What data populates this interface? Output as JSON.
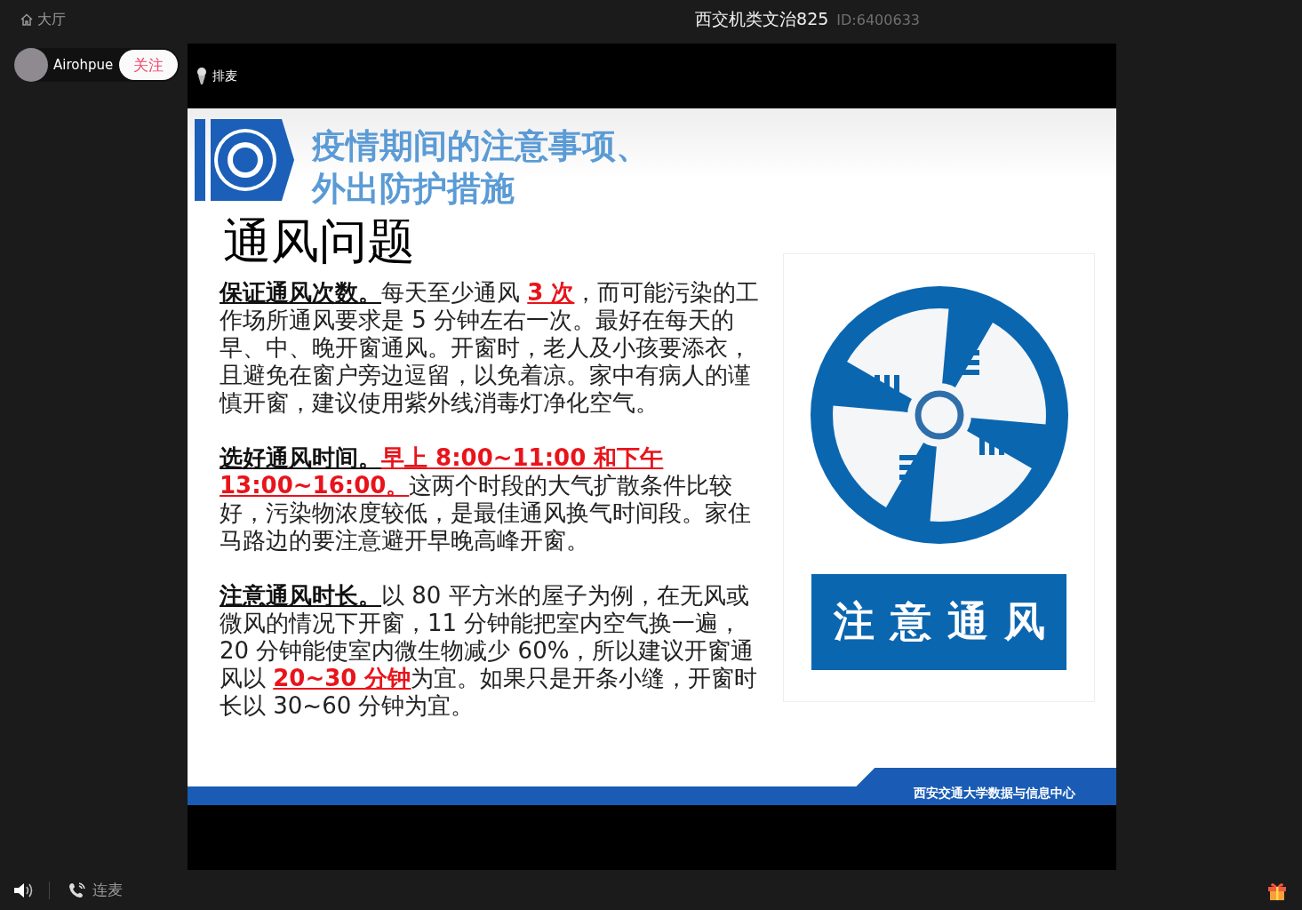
{
  "top_bar": {
    "home_label": "大厅",
    "room_title": "西交机类文治825",
    "room_id": "ID:6400633"
  },
  "host": {
    "name": "Airohpue",
    "follow_label": "关注"
  },
  "stage": {
    "queue_label": "排麦"
  },
  "slide": {
    "title_lines": [
      "疫情期间的注意事项、",
      "外出防护措施"
    ],
    "heading": "通风问题",
    "paragraphs": [
      [
        {
          "kind": "lead",
          "text": "保证通风次数。"
        },
        {
          "kind": "plain",
          "text": "每天至少通风 "
        },
        {
          "kind": "red",
          "text": "3 次"
        },
        {
          "kind": "plain",
          "text": "，而可能污染的工作场所通风要求是 5 分钟左右一次。最好在每天的早、中、晚开窗通风。开窗时，老人及小孩要添衣，且避免在窗户旁边逗留，以免着凉。家中有病人的谨慎开窗，建议使用紫外线消毒灯净化空气。"
        }
      ],
      [
        {
          "kind": "lead",
          "text": "选好通风时间。"
        },
        {
          "kind": "red",
          "text": "早上 8:00~11:00 和下午 13:00~16:00。"
        },
        {
          "kind": "plain",
          "text": "这两个时段的大气扩散条件比较好，污染物浓度较低，是最佳通风换气时间段。家住马路边的要注意避开早晚高峰开窗。"
        }
      ],
      [
        {
          "kind": "lead",
          "text": "注意通风时长。"
        },
        {
          "kind": "plain",
          "text": "以 80 平方米的屋子为例，在无风或微风的情况下开窗，11 分钟能把室内空气换一遍，20 分钟能使室内微生物减少 60%，所以建议开窗通风以 "
        },
        {
          "kind": "red",
          "text": "20~30 分钟"
        },
        {
          "kind": "plain",
          "text": "为宜。如果只是开条小缝，开窗时长以 30~60 分钟为宜。"
        }
      ]
    ],
    "sign_label": "注意通风",
    "footer": "西安交通大学数据与信息中心"
  },
  "bottom_bar": {
    "mic_label": "连麦"
  }
}
